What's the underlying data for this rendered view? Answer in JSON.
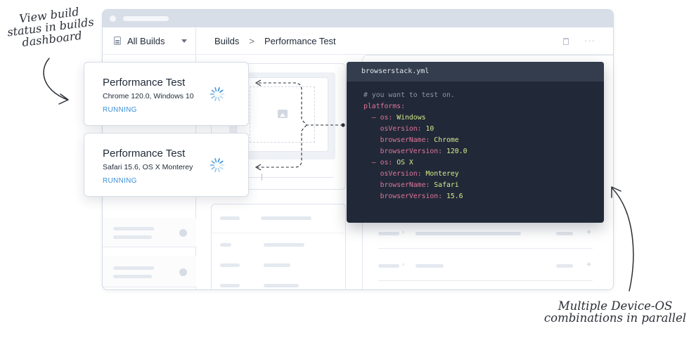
{
  "annotations": {
    "left": [
      "View build",
      "status in builds",
      "dashboard"
    ],
    "right": [
      "Multiple Device-OS",
      "combinations in parallel"
    ]
  },
  "sidebar": {
    "dropdown_label": "All Builds"
  },
  "breadcrumb": {
    "root": "Builds",
    "separator": ">",
    "current": "Performance Test"
  },
  "builds": [
    {
      "title": "Performance Test",
      "subtitle": "Chrome 120.0, Windows 10",
      "status": "RUNNING"
    },
    {
      "title": "Performance Test",
      "subtitle": "Safari 15.6, OS X Monterey",
      "status": "RUNNING"
    }
  ],
  "code": {
    "filename": "browserstack.yml",
    "comment": "# you want to test on.",
    "root_key": "platforms:",
    "entries": [
      {
        "os": "Windows",
        "osVersion": "10",
        "browserName": "Chrome",
        "browserVersion": "120.0"
      },
      {
        "os": "OS X",
        "osVersion": "Monterey",
        "browserName": "Safari",
        "browserVersion": "15.6"
      }
    ],
    "labels": {
      "os": "os:",
      "osVersion": "osVersion:",
      "browserName": "browserName:",
      "browserVersion": "browserVersion:",
      "dash": "–"
    }
  },
  "colors": {
    "status_running": "#3b8fd8",
    "code_bg": "#212938",
    "code_key": "#e0749a",
    "code_value": "#d5ea8c",
    "window_titlebar": "#d7dee8"
  },
  "icons": [
    "document-icon",
    "chevron-down-icon",
    "trash-icon",
    "more-icon",
    "image-placeholder-icon",
    "spinner-icon",
    "info-icon"
  ]
}
